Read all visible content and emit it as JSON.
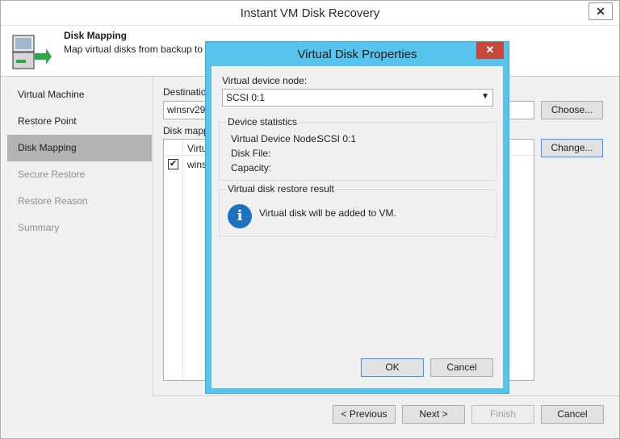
{
  "window": {
    "title": "Instant VM Disk Recovery",
    "close_glyph": "✕"
  },
  "header": {
    "title": "Disk Mapping",
    "subtitle": "Map virtual disks from backup to",
    "icon": "disk-mapping-icon"
  },
  "nav": {
    "items": [
      {
        "label": "Virtual Machine",
        "state": "normal"
      },
      {
        "label": "Restore Point",
        "state": "normal"
      },
      {
        "label": "Disk Mapping",
        "state": "active"
      },
      {
        "label": "Secure Restore",
        "state": "disabled"
      },
      {
        "label": "Restore Reason",
        "state": "disabled"
      },
      {
        "label": "Summary",
        "state": "disabled"
      }
    ]
  },
  "main": {
    "destination_label": "Destination",
    "destination_value": "winsrv29",
    "choose_button": "Choose...",
    "disk_mapping_label": "Disk mapp",
    "table_col_header": "Virtu",
    "row_text": "wins",
    "change_button": "Change..."
  },
  "footer": {
    "previous": "< Previous",
    "next": "Next >",
    "finish": "Finish",
    "cancel": "Cancel"
  },
  "dialog": {
    "title": "Virtual Disk Properties",
    "close_glyph": "✕",
    "device_node_label": "Virtual device node:",
    "device_node_value": "SCSI 0:1",
    "stats_group_title": "Device statistics",
    "stats": [
      {
        "label": "Virtual Device Node:",
        "value": "SCSI 0:1"
      },
      {
        "label": "Disk File:",
        "value": ""
      },
      {
        "label": "Capacity:",
        "value": ""
      }
    ],
    "result_group_title": "Virtual disk restore result",
    "result_icon": "info-icon",
    "result_text": "Virtual disk will be added to VM.",
    "ok": "OK",
    "cancel": "Cancel"
  },
  "colors": {
    "dialog_frame": "#56c4ec",
    "close_red": "#c7473a",
    "info_blue": "#1d72c2",
    "nav_active": "#b3b3b3"
  }
}
